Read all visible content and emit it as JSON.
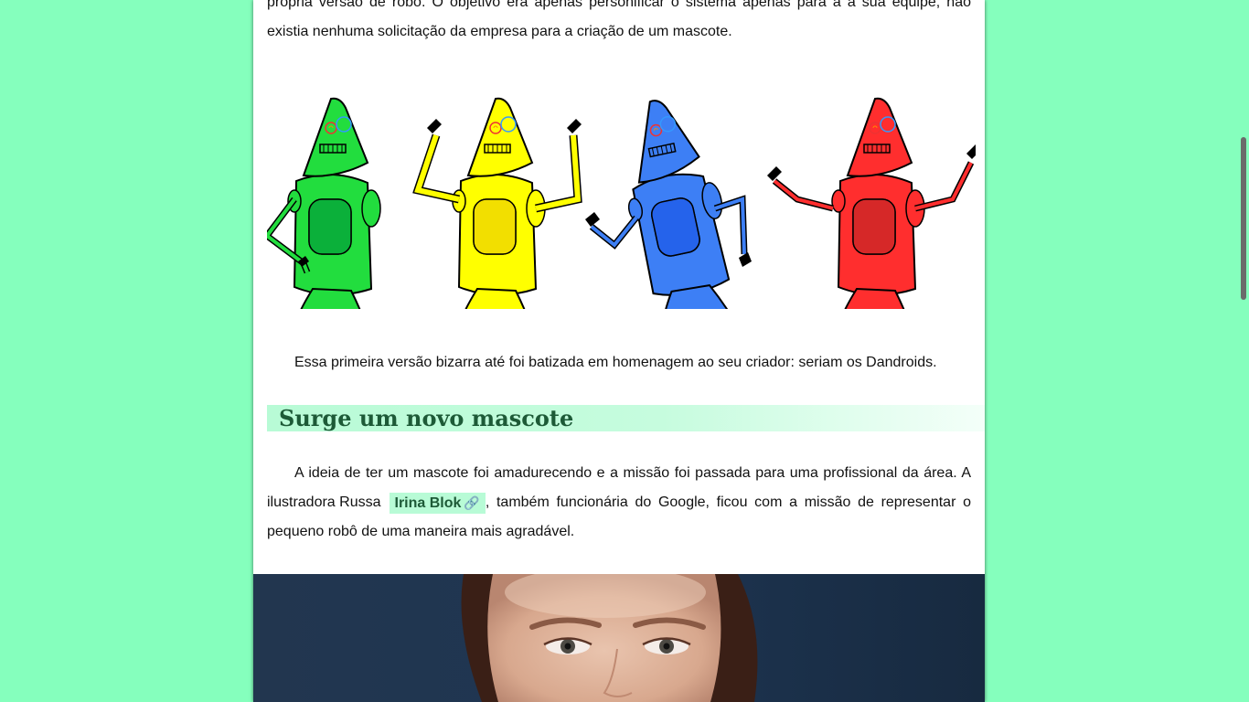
{
  "article": {
    "intro_line1": "própria versão de robô. O objetivo era apenas personificar o sistema apenas para a a sua equipe, não",
    "intro_line2": "existia nenhuma solicitação da empresa para a criação de um mascote.",
    "caption": "Essa primeira versão bizarra até foi batizada em homenagem ao seu criador: seriam os Dandroids.",
    "section_heading": "Surge um novo mascote",
    "para_line1": "A ideia de ter um mascote foi amadurecendo e a missão foi passada para uma profissional da área. A",
    "para_line2_before": "ilustradora Russa",
    "link_text": "Irina Blok",
    "link_icon": "🔗",
    "para_line2_after": ", também funcionária do Google, ficou com a missão de representar o",
    "para_line3": "pequeno robô de uma maneira mais agradável."
  },
  "robots": [
    {
      "name": "green-robot",
      "color": "#22dd3e",
      "dark": "#0bb03a"
    },
    {
      "name": "yellow-robot",
      "color": "#ffff00",
      "dark": "#f2df00"
    },
    {
      "name": "blue-robot",
      "color": "#3d7ff5",
      "dark": "#2563eb"
    },
    {
      "name": "red-robot",
      "color": "#ff2e2e",
      "dark": "#d62828"
    }
  ],
  "colors": {
    "background": "#85ffbd",
    "heading_text": "#1d5a37",
    "heading_bg": "#b8fbd6"
  },
  "icons": [
    "link-icon"
  ]
}
